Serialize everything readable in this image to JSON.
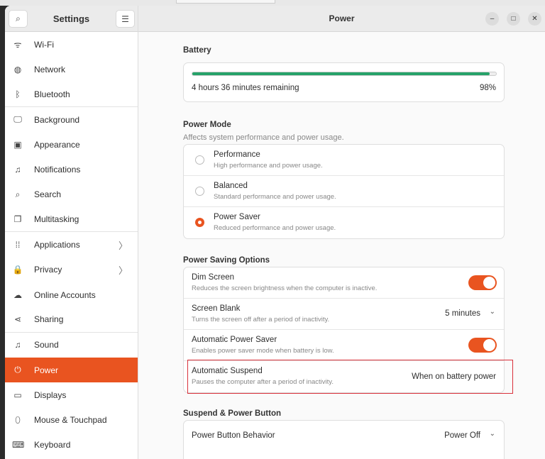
{
  "sidebar": {
    "title": "Settings",
    "items": [
      {
        "label": "Wi-Fi",
        "icon": "wifi-icon",
        "glyph": "ᯤ"
      },
      {
        "label": "Network",
        "icon": "globe-icon",
        "glyph": "◍"
      },
      {
        "label": "Bluetooth",
        "icon": "bluetooth-icon",
        "glyph": "ᛒ"
      },
      {
        "label": "Background",
        "icon": "monitor-icon",
        "glyph": "🖵"
      },
      {
        "label": "Appearance",
        "icon": "appearance-icon",
        "glyph": "▣"
      },
      {
        "label": "Notifications",
        "icon": "bell-icon",
        "glyph": "♫"
      },
      {
        "label": "Search",
        "icon": "search-icon",
        "glyph": "⌕"
      },
      {
        "label": "Multitasking",
        "icon": "multitasking-icon",
        "glyph": "❐"
      },
      {
        "label": "Applications",
        "icon": "grid-icon",
        "glyph": "⁞⁞"
      },
      {
        "label": "Privacy",
        "icon": "lock-icon",
        "glyph": "🔒"
      },
      {
        "label": "Online Accounts",
        "icon": "cloud-icon",
        "glyph": "☁"
      },
      {
        "label": "Sharing",
        "icon": "share-icon",
        "glyph": "⋖"
      },
      {
        "label": "Sound",
        "icon": "music-icon",
        "glyph": "♫"
      },
      {
        "label": "Power",
        "icon": "power-icon",
        "glyph": "⏻"
      },
      {
        "label": "Displays",
        "icon": "display-icon",
        "glyph": "▭"
      },
      {
        "label": "Mouse & Touchpad",
        "icon": "mouse-icon",
        "glyph": "⬯"
      },
      {
        "label": "Keyboard",
        "icon": "keyboard-icon",
        "glyph": "⌨"
      }
    ]
  },
  "header": {
    "title": "Power"
  },
  "battery": {
    "heading": "Battery",
    "remaining": "4 hours 36 minutes remaining",
    "percent_label": "98%",
    "level": 0.98,
    "bar_color": "#26a269"
  },
  "power_mode": {
    "heading": "Power Mode",
    "subtitle": "Affects system performance and power usage.",
    "options": [
      {
        "title": "Performance",
        "desc": "High performance and power usage.",
        "selected": false
      },
      {
        "title": "Balanced",
        "desc": "Standard performance and power usage.",
        "selected": false
      },
      {
        "title": "Power Saver",
        "desc": "Reduced performance and power usage.",
        "selected": true
      }
    ]
  },
  "saving": {
    "heading": "Power Saving Options",
    "dim": {
      "title": "Dim Screen",
      "desc": "Reduces the screen brightness when the computer is inactive.",
      "on": true
    },
    "blank": {
      "title": "Screen Blank",
      "desc": "Turns the screen off after a period of inactivity.",
      "value": "5 minutes"
    },
    "auto_saver": {
      "title": "Automatic Power Saver",
      "desc": "Enables power saver mode when battery is low.",
      "on": true
    },
    "suspend": {
      "title": "Automatic Suspend",
      "desc": "Pauses the computer after a period of inactivity.",
      "value": "When on battery power"
    }
  },
  "suspend_section": {
    "heading": "Suspend & Power Button",
    "button_behavior": {
      "title": "Power Button Behavior",
      "value": "Power Off"
    }
  },
  "accent": "#e95420"
}
